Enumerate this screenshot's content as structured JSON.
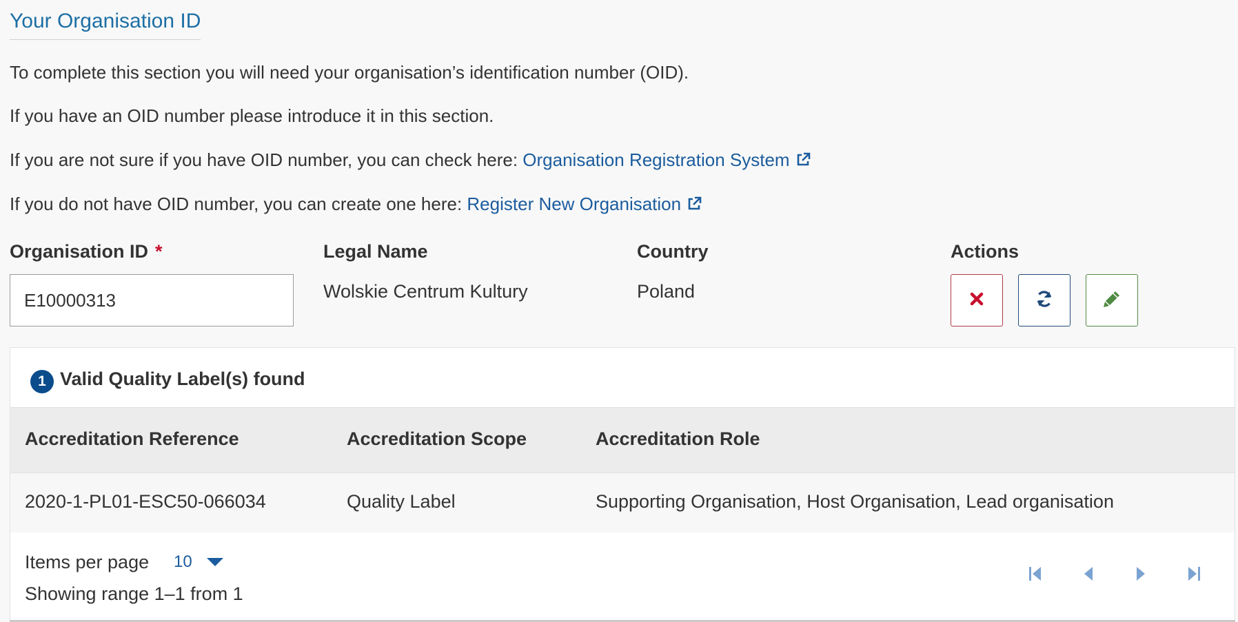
{
  "section": {
    "title": "Your Organisation ID"
  },
  "intro": {
    "line1": "To complete this section you will need your organisation’s identification number (OID).",
    "line2": "If you have an OID number please introduce it in this section.",
    "line3_text": "If you are not sure if you have OID number, you can check here: ",
    "line3_link": "Organisation Registration System",
    "line4_text": "If you do not have OID number, you can create one here: ",
    "line4_link": "Register New Organisation"
  },
  "form": {
    "oid_label": "Organisation ID",
    "required_mark": "*",
    "oid_value": "E10000313",
    "legal_name_label": "Legal Name",
    "legal_name_value": "Wolskie Centrum Kultury",
    "country_label": "Country",
    "country_value": "Poland",
    "actions_label": "Actions"
  },
  "actions": {
    "remove_icon": "close-icon",
    "refresh_icon": "refresh-icon",
    "edit_icon": "pencil-icon"
  },
  "quality_labels": {
    "count": "1",
    "title": "Valid Quality Label(s) found",
    "columns": [
      "Accreditation Reference",
      "Accreditation Scope",
      "Accreditation Role"
    ],
    "rows": [
      [
        "2020-1-PL01-ESC50-066034",
        "Quality Label",
        "Supporting Organisation, Host Organisation, Lead organisation"
      ]
    ],
    "items_per_page_label": "Items per page",
    "items_per_page_value": "10",
    "range_text": "Showing range 1–1 from 1"
  },
  "colors": {
    "title_blue": "#1d6fa5",
    "link_blue": "#1b5c9e",
    "badge_blue": "#0b4c8c",
    "remove_red": "#c8102e",
    "edit_green": "#4f8a42",
    "pager_blue": "#7ba3d1"
  }
}
